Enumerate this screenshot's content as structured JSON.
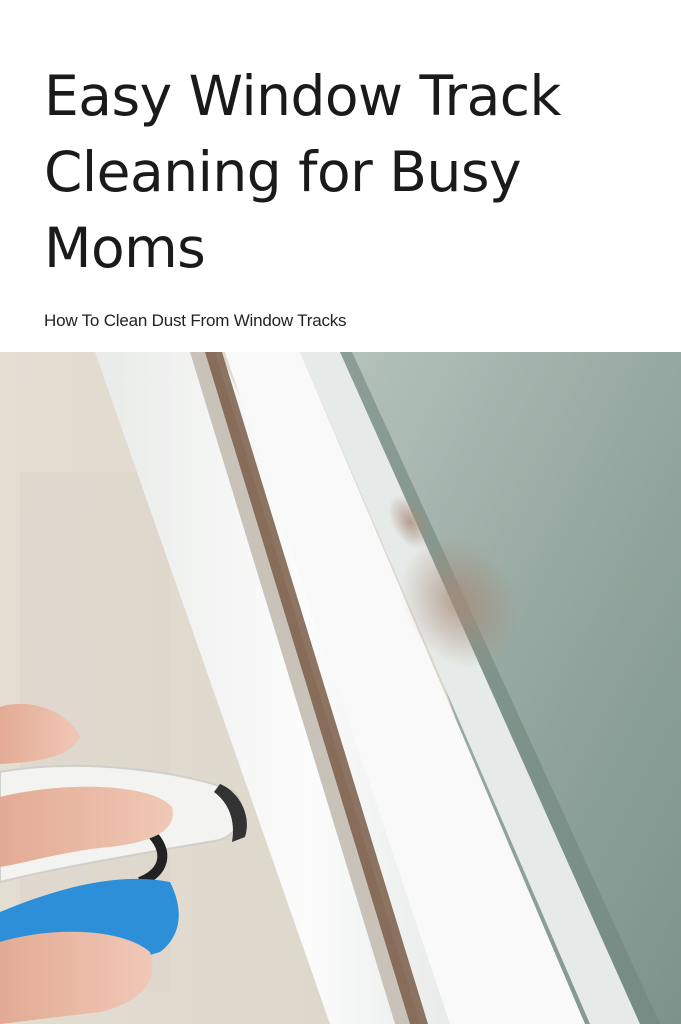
{
  "header": {
    "title": "Easy Window Track Cleaning for Busy Moms",
    "subtitle": "How To Clean Dust From Window Tracks"
  },
  "photo": {
    "subject": "hand-cleaning-window-track",
    "colors": {
      "wall": "#e6e0d6",
      "frame": "#f4f5f3",
      "glass": "#8fa39c",
      "brush": "#2f8fd6",
      "skin": "#e8b9a3"
    }
  }
}
